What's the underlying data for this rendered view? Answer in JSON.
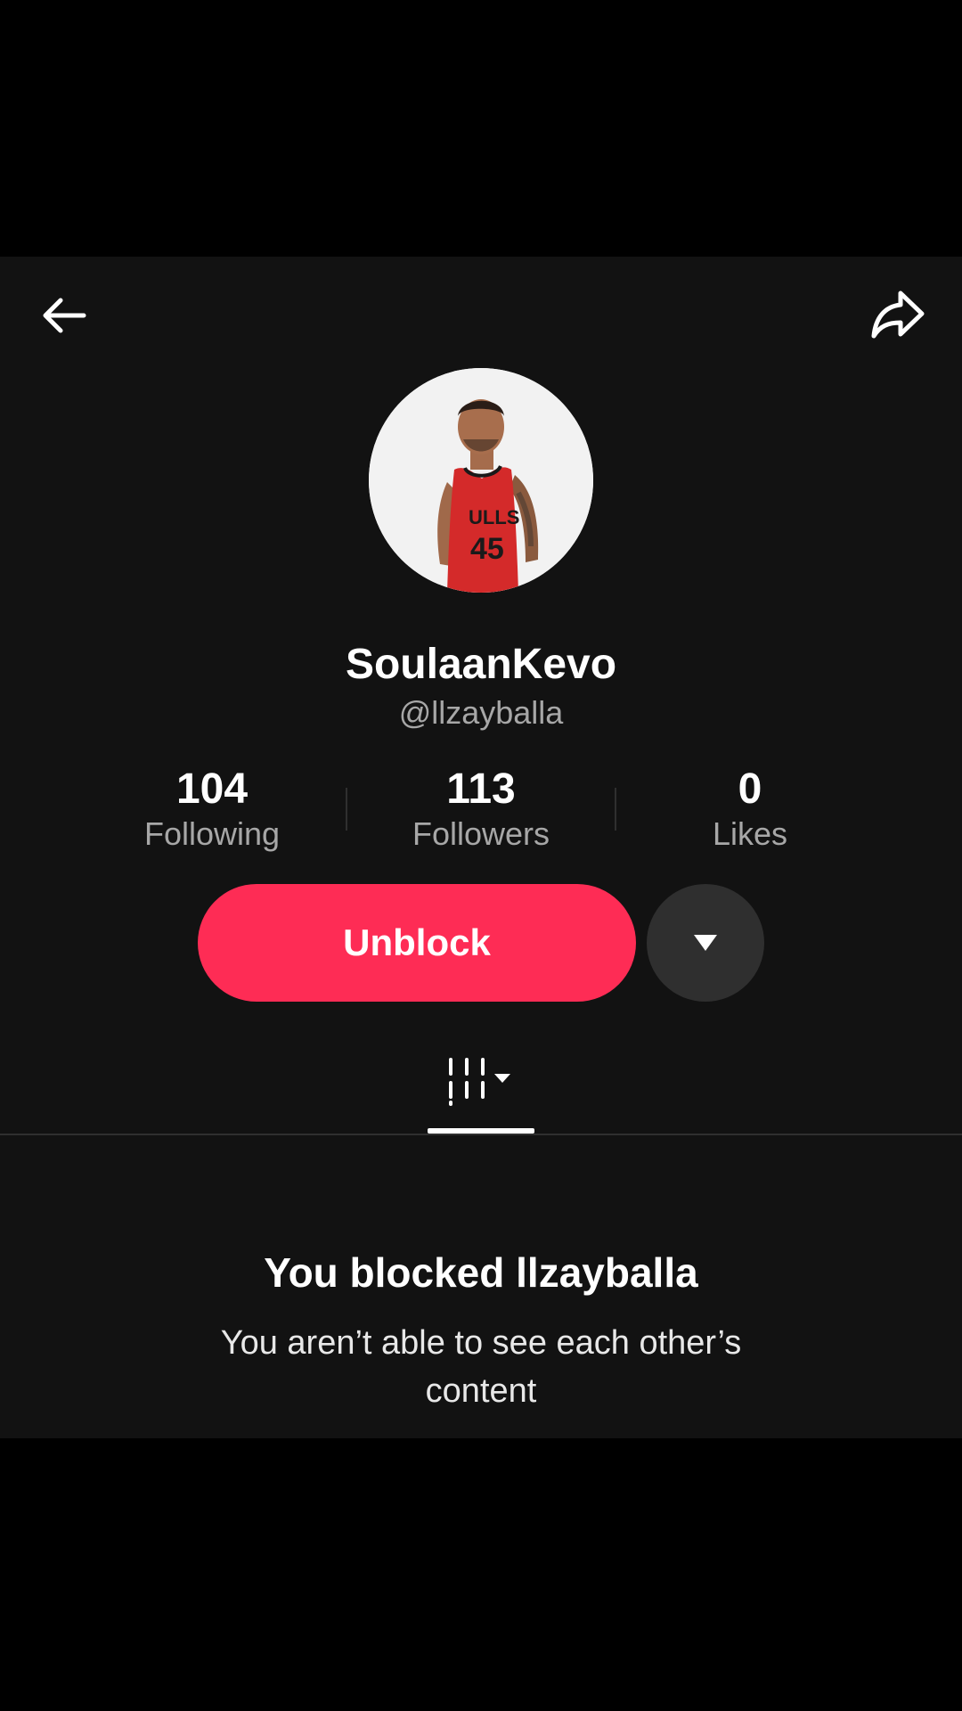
{
  "header": {
    "back_icon": "arrow-left-icon",
    "share_icon": "share-arrow-icon"
  },
  "profile": {
    "display_name": "SoulaanKevo",
    "handle": "@llzayballa",
    "avatar_icon": "profile-photo"
  },
  "stats": [
    {
      "value": "104",
      "label": "Following"
    },
    {
      "value": "113",
      "label": "Followers"
    },
    {
      "value": "0",
      "label": "Likes"
    }
  ],
  "actions": {
    "unblock_label": "Unblock",
    "more_icon": "caret-down-icon"
  },
  "tabs": {
    "videos_icon": "grid-columns-icon",
    "dropdown_icon": "caret-down-icon"
  },
  "blocked_notice": {
    "title": "You blocked llzayballa",
    "description": "You aren’t able to see each other’s content"
  },
  "colors": {
    "accent": "#fe2c55",
    "background": "#121212",
    "secondary_text": "#a7a7a7"
  }
}
